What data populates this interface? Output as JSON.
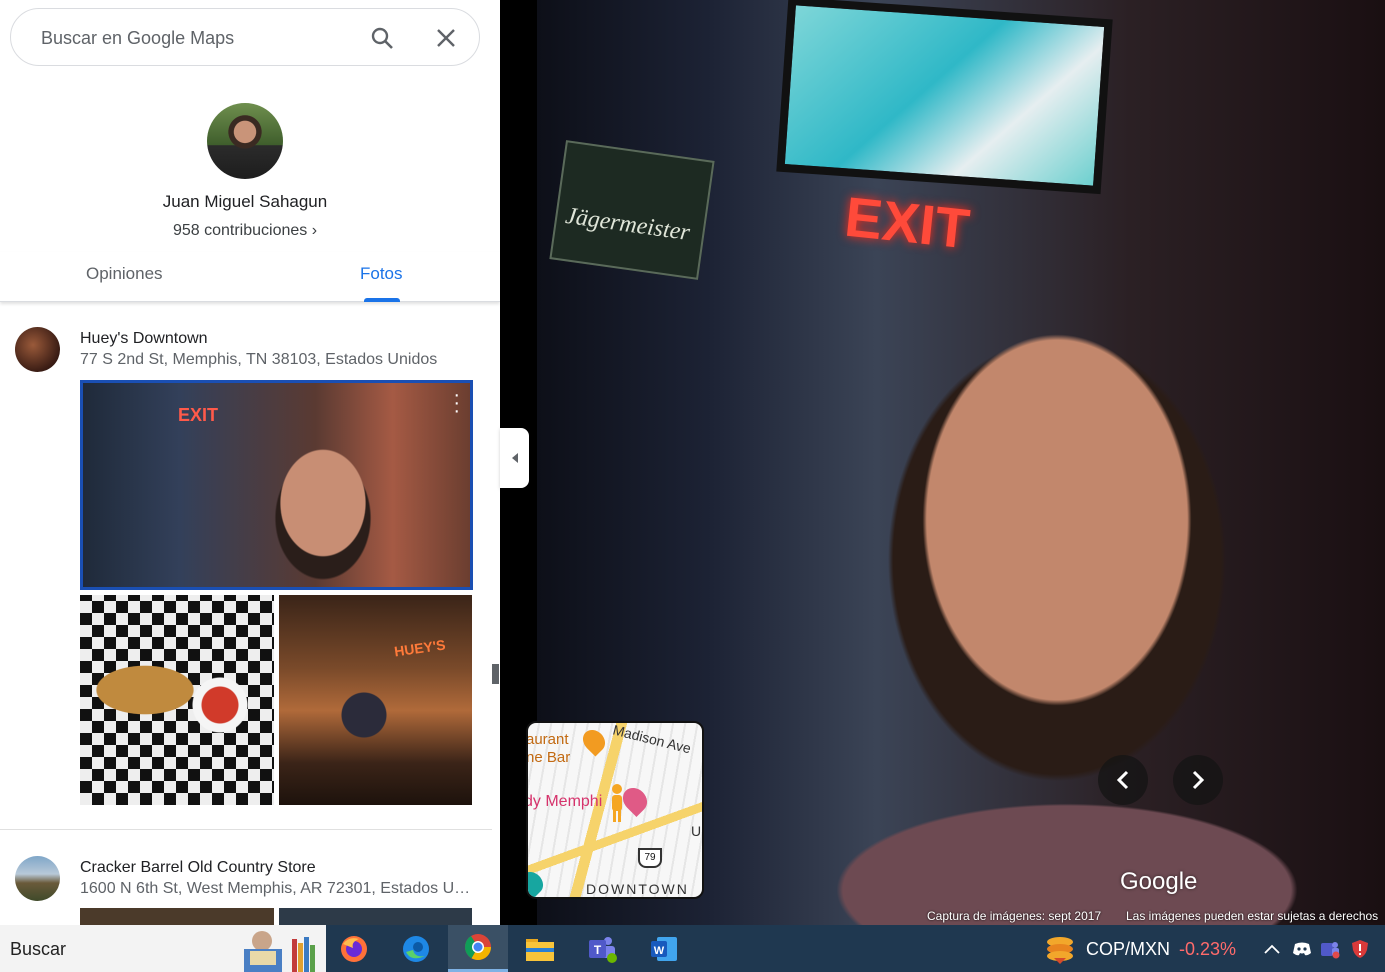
{
  "search": {
    "placeholder": "Buscar en Google Maps"
  },
  "profile": {
    "name": "Juan Miguel Sahagun",
    "contributions": "958 contribuciones ›"
  },
  "tabs": [
    {
      "label": "Opiniones"
    },
    {
      "label": "Fotos",
      "active": true
    }
  ],
  "places": [
    {
      "name": "Huey's Downtown",
      "address": "77 S 2nd St, Memphis, TN 38103, Estados Unidos"
    },
    {
      "name": "Cracker Barrel Old Country Store",
      "address": "1600 N 6th St, West Memphis, AR 72301, Estados Un..."
    }
  ],
  "photo_signs": {
    "exit": "EXIT",
    "bar": "HUEY'S"
  },
  "viewer": {
    "exit_sign": "EXIT",
    "jager_sign": "Jägermeister",
    "logo": "Google",
    "capture_date": "Captura de imágenes: sept 2017",
    "rights": "Las imágenes pueden estar sujetas a derechos"
  },
  "minimap": {
    "restaurant": "aurant\nne Bar",
    "street": "Madison Ave",
    "place": "dy Memphi",
    "district": "DOWNTOWN",
    "route": "79",
    "road_letter": "U"
  },
  "taskbar": {
    "search": "Buscar",
    "apps": [
      "firefox-icon",
      "edge-icon",
      "chrome-icon",
      "file-explorer-icon",
      "teams-icon",
      "word-icon"
    ],
    "ticker": "COP/MXN",
    "ticker_change": "-0.23%"
  },
  "colors": {
    "accent": "#1a73e8",
    "selected_border": "#1a4fb3",
    "taskbar": "#1f3850",
    "negative": "#ff6b6b"
  }
}
